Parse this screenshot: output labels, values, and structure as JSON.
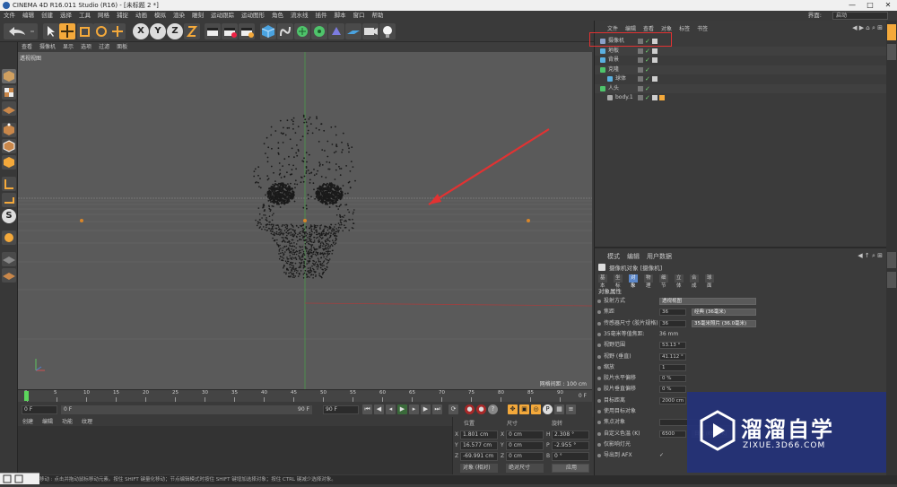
{
  "window": {
    "title": "CINEMA 4D R16.011 Studio (R16) - [未标题 2 *]",
    "controls": [
      "—",
      "□",
      "✕"
    ]
  },
  "menubar": {
    "items": [
      "文件",
      "编辑",
      "创建",
      "选择",
      "工具",
      "网格",
      "捕捉",
      "动画",
      "模拟",
      "渲染",
      "雕刻",
      "运动跟踪",
      "运动图形",
      "角色",
      "流水线",
      "插件",
      "脚本",
      "窗口",
      "帮助"
    ],
    "layout_label": "界面:",
    "layout_value": "启动"
  },
  "toolbar": {
    "icons": [
      "undo-icon",
      "select-icon",
      "move-icon",
      "scale-icon",
      "rotate-icon",
      "live-select-icon",
      "x-axis-icon",
      "y-axis-icon",
      "z-axis-icon",
      "coord-system-icon",
      "render-view-icon",
      "render-picture-icon",
      "edit-render-settings-icon",
      "cube-icon",
      "spline-pen-icon",
      "subdivision-icon",
      "array-icon",
      "deformer-icon",
      "floor-icon",
      "camera-icon",
      "light-icon"
    ],
    "axis_labels": [
      "X",
      "Y",
      "Z"
    ]
  },
  "viewport": {
    "menu": [
      "查看",
      "摄像机",
      "显示",
      "选项",
      "过滤",
      "面板"
    ],
    "title": "透视视图",
    "grid_status": "网格间距 : 100 cm"
  },
  "timeline": {
    "ticks": [
      "0",
      "5",
      "10",
      "15",
      "20",
      "25",
      "30",
      "35",
      "40",
      "45",
      "50",
      "55",
      "60",
      "65",
      "70",
      "75",
      "80",
      "85",
      "90"
    ],
    "current_frame_marker": "0 F",
    "start": "0 F",
    "current": "0 F",
    "end": "90 F",
    "max": "90 F",
    "progress": 0
  },
  "materials": {
    "menu": [
      "创建",
      "编辑",
      "功能",
      "纹理"
    ]
  },
  "coordinates": {
    "headers": [
      "位置",
      "尺寸",
      "旋转"
    ],
    "rows": [
      {
        "axis": "X",
        "pos": "1.801 cm",
        "size_axis": "X",
        "size": "0 cm",
        "rot_axis": "H",
        "rot": "2.308 °"
      },
      {
        "axis": "Y",
        "pos": "16.577 cm",
        "size_axis": "Y",
        "size": "0 cm",
        "rot_axis": "P",
        "rot": "-2.955 °"
      },
      {
        "axis": "Z",
        "pos": "-69.991 cm",
        "size_axis": "Z",
        "size": "0 cm",
        "rot_axis": "B",
        "rot": "0 °"
      }
    ],
    "mode_object": "对象 (相对)",
    "mode_size": "绝对尺寸",
    "apply": "应用"
  },
  "statusbar": {
    "text": "移动 : 点击并拖动鼠标移动元素。按住 SHIFT 键量化移动；节点编辑模式时按住 SHIFT 键增加选择对象；按住 CTRL 键减少选择对象。"
  },
  "objects": {
    "menu": [
      "文件",
      "编辑",
      "查看",
      "对象",
      "标签",
      "书签"
    ],
    "items": [
      {
        "name": "摄像机",
        "icon_color": "#8aa0c8",
        "indent": 0,
        "tags": 1
      },
      {
        "name": "地板",
        "icon_color": "#5ab0e0",
        "indent": 0,
        "tags": 1
      },
      {
        "name": "背景",
        "icon_color": "#5ab0e0",
        "indent": 0,
        "tags": 1
      },
      {
        "name": "克隆",
        "icon_color": "#4fc46b",
        "indent": 0,
        "tags": 0
      },
      {
        "name": "球体",
        "icon_color": "#5ab0e0",
        "indent": 1,
        "tags": 1
      },
      {
        "name": "人头",
        "icon_color": "#4fc46b",
        "indent": 0,
        "tags": 0
      },
      {
        "name": "body.1",
        "icon_color": "#aaaaaa",
        "indent": 1,
        "tags": 2
      }
    ]
  },
  "attributes": {
    "menu": [
      "模式",
      "编辑",
      "用户数据"
    ],
    "header": "摄像机对象 [摄像机]",
    "tabs": [
      "基本",
      "坐标",
      "对象",
      "物理",
      "细节",
      "立体",
      "合成",
      "球面"
    ],
    "active_tab": "对象",
    "section": "对象属性",
    "rows": [
      {
        "label": "投射方式",
        "value": "透视视图",
        "kind": "select"
      },
      {
        "label": "焦距",
        "value": "36",
        "kind": "field",
        "extra": "经典 (36毫米)"
      },
      {
        "label": "传感器尺寸 (胶片规格)",
        "value": "36",
        "kind": "field",
        "extra": "35毫米照片 (36.0毫米)"
      },
      {
        "label": "35毫米等值焦距:",
        "value": "36 mm",
        "kind": "text"
      },
      {
        "label": "视野范围",
        "value": "53.13 °",
        "kind": "field"
      },
      {
        "label": "视野 (垂直)",
        "value": "41.112 °",
        "kind": "field"
      },
      {
        "label": "缩放",
        "value": "1",
        "kind": "field"
      },
      {
        "label": "胶片水平偏移",
        "value": "0 %",
        "kind": "field"
      },
      {
        "label": "胶片垂直偏移",
        "value": "0 %",
        "kind": "field"
      },
      {
        "label": "目标距离",
        "value": "2000 cm",
        "kind": "field"
      },
      {
        "label": "使用目标对象",
        "value": "",
        "kind": "check"
      },
      {
        "label": "焦点对象",
        "value": "",
        "kind": "link"
      },
      {
        "label": "自定义色温 (K)",
        "value": "6500",
        "kind": "field",
        "extra": "日光 (6500 K)"
      },
      {
        "label": "仅影响灯光",
        "value": "",
        "kind": "check"
      },
      {
        "label": "导出到 AFX",
        "value": "✓",
        "kind": "check"
      }
    ]
  },
  "watermark": {
    "cn": "溜溜自学",
    "en": "ZIXUE.3D66.COM"
  },
  "colors": {
    "highlight_box": "#e23232",
    "arrow": "#e23232",
    "accent": "#f4a93b",
    "watermark_bg": "#243278"
  }
}
